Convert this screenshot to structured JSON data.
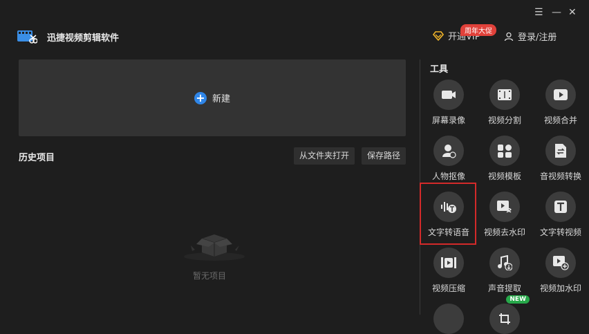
{
  "window": {
    "menu_icon": "hamburger-icon",
    "minimize_icon": "minimize-icon",
    "close_icon": "close-icon"
  },
  "header": {
    "app_title": "迅捷视频剪辑软件",
    "vip_label": "开通VIP",
    "promo_badge": "周年大促",
    "login_label": "登录/注册"
  },
  "main": {
    "new_label": "新建",
    "history_title": "历史项目",
    "open_folder_button": "从文件夹打开",
    "save_path_button": "保存路径",
    "empty_text": "暂无项目"
  },
  "tools": {
    "title": "工具",
    "items": [
      {
        "label": "屏幕录像",
        "icon": "camera-icon"
      },
      {
        "label": "视频分割",
        "icon": "film-cut-icon"
      },
      {
        "label": "视频合并",
        "icon": "play-merge-icon"
      },
      {
        "label": "人物抠像",
        "icon": "person-cutout-icon"
      },
      {
        "label": "视频模板",
        "icon": "template-icon"
      },
      {
        "label": "音视频转换",
        "icon": "convert-icon"
      },
      {
        "label": "文字转语音",
        "icon": "text-to-speech-icon"
      },
      {
        "label": "视频去水印",
        "icon": "remove-watermark-icon"
      },
      {
        "label": "文字转视频",
        "icon": "text-to-video-icon"
      },
      {
        "label": "视频压缩",
        "icon": "compress-icon"
      },
      {
        "label": "声音提取",
        "icon": "music-extract-icon"
      },
      {
        "label": "视频加水印",
        "icon": "add-watermark-icon"
      }
    ],
    "new_badge": "NEW"
  },
  "colors": {
    "accent": "#2f86e8",
    "promo": "#e0413a",
    "highlight": "#d42a2a",
    "new": "#27a84a"
  }
}
